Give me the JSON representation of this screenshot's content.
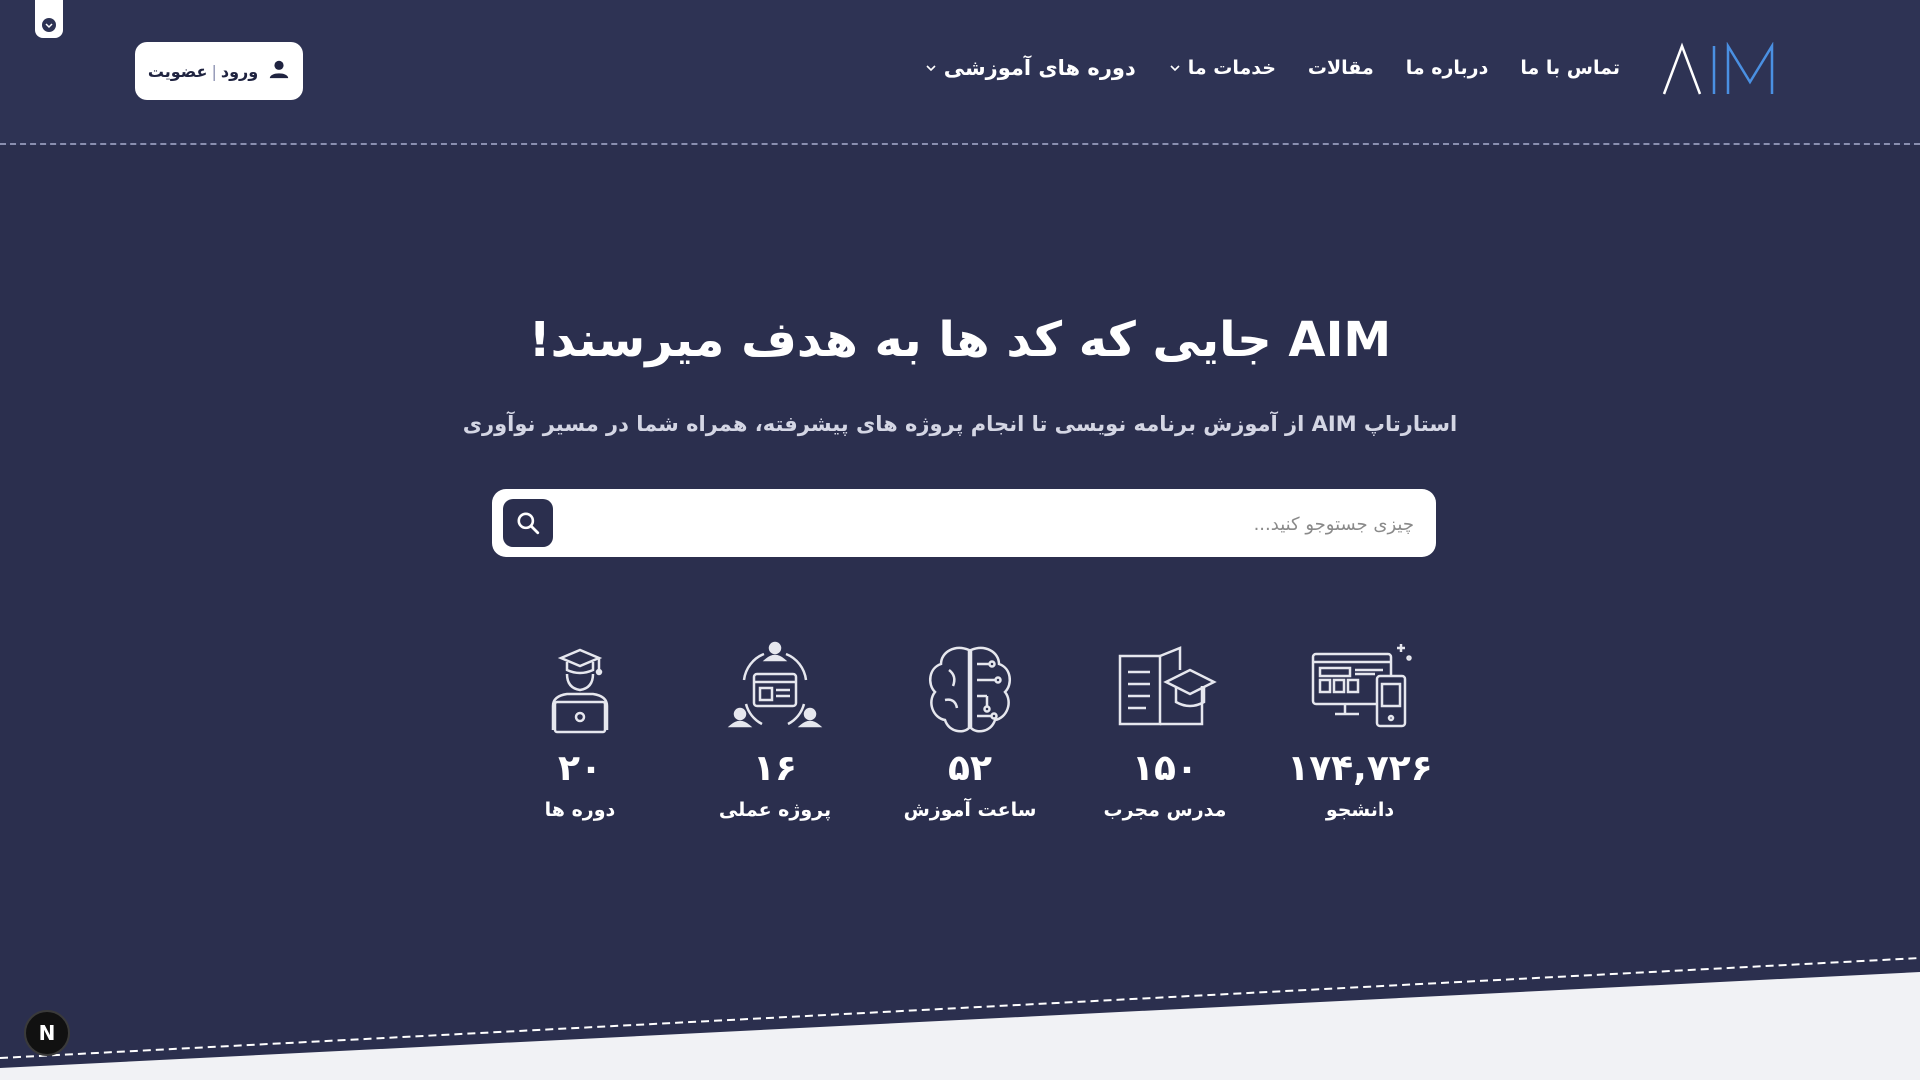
{
  "header": {
    "login_label": "ورود",
    "signup_label": "عضویت",
    "separator": "|",
    "nav": [
      {
        "label": "دوره های آموزشی",
        "has_dropdown": true
      },
      {
        "label": "خدمات ما",
        "has_dropdown": true
      },
      {
        "label": "مقالات",
        "has_dropdown": false
      },
      {
        "label": "درباره ما",
        "has_dropdown": false
      },
      {
        "label": "تماس با ما",
        "has_dropdown": false
      }
    ],
    "logo_text": "AIM"
  },
  "hero": {
    "title": "AIM جایی که کد ها به هدف میرسند!",
    "subtitle": "استارتاپ AIM از آموزش برنامه نویسی تا انجام پروژه های پیشرفته، همراه شما در مسیر نوآوری"
  },
  "search": {
    "placeholder": "چیزی جستوجو کنید..."
  },
  "stats": [
    {
      "number": "۱۷۴,۷۲۶",
      "label": "دانشجو",
      "icon": "devices-icon"
    },
    {
      "number": "۱۵۰",
      "label": "مدرس مجرب",
      "icon": "book-graduation-icon"
    },
    {
      "number": "۵۲",
      "label": "ساعت آموزش",
      "icon": "brain-circuit-icon"
    },
    {
      "number": "۱۶",
      "label": "پروژه عملی",
      "icon": "project-team-icon"
    },
    {
      "number": "۲۰",
      "label": "دوره ها",
      "icon": "student-laptop-icon"
    }
  ],
  "colors": {
    "background": "#2b2f4e",
    "header_bg": "#2e3354",
    "accent_logo": "#4a90e2",
    "bottom_bg": "#f1f2f5"
  },
  "badge": {
    "letter": "N"
  }
}
